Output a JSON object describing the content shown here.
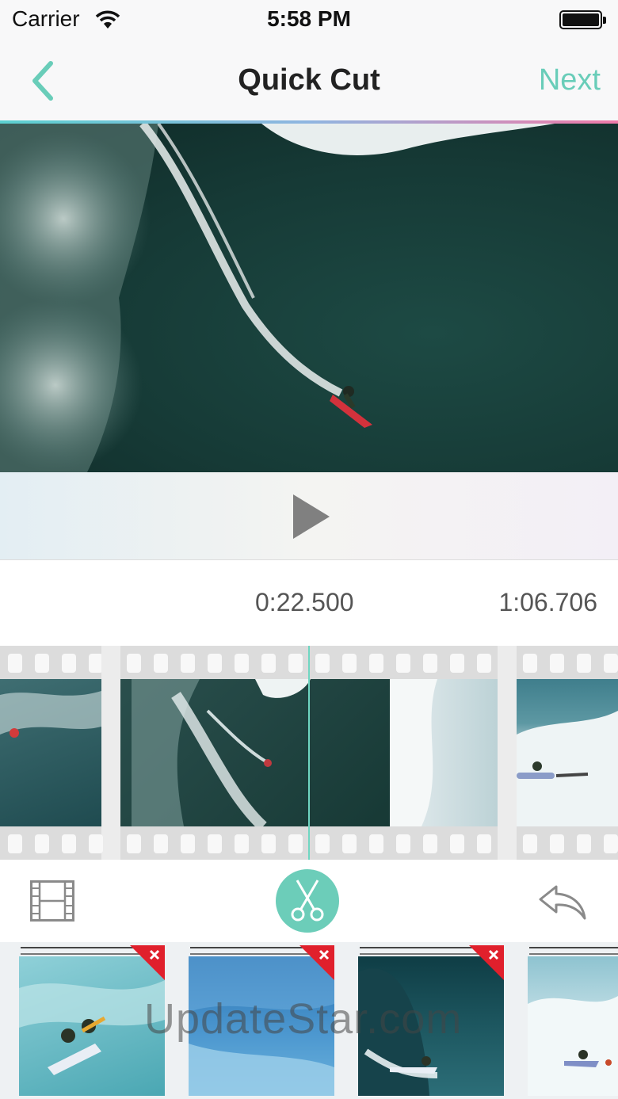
{
  "status_bar": {
    "carrier": "Carrier",
    "time": "5:58 PM",
    "wifi_icon": "wifi-icon",
    "battery_icon": "battery-icon"
  },
  "nav": {
    "back_icon": "chevron-left-icon",
    "title": "Quick Cut",
    "next_label": "Next"
  },
  "player": {
    "play_icon": "play-icon"
  },
  "timeline": {
    "current_time": "0:22.500",
    "total_time": "1:06.706"
  },
  "toolbar": {
    "left_icon": "film-strip-icon",
    "center_icon": "scissors-icon",
    "right_icon": "undo-icon"
  },
  "clips": [
    {
      "delete_icon": "delete-icon"
    },
    {
      "delete_icon": "delete-icon"
    },
    {
      "delete_icon": "delete-icon"
    },
    {}
  ],
  "watermark": "UpdateStar.com",
  "colors": {
    "accent": "#6ccdb9",
    "delete_badge": "#e0202c",
    "playhead": "#6fd6c2"
  }
}
